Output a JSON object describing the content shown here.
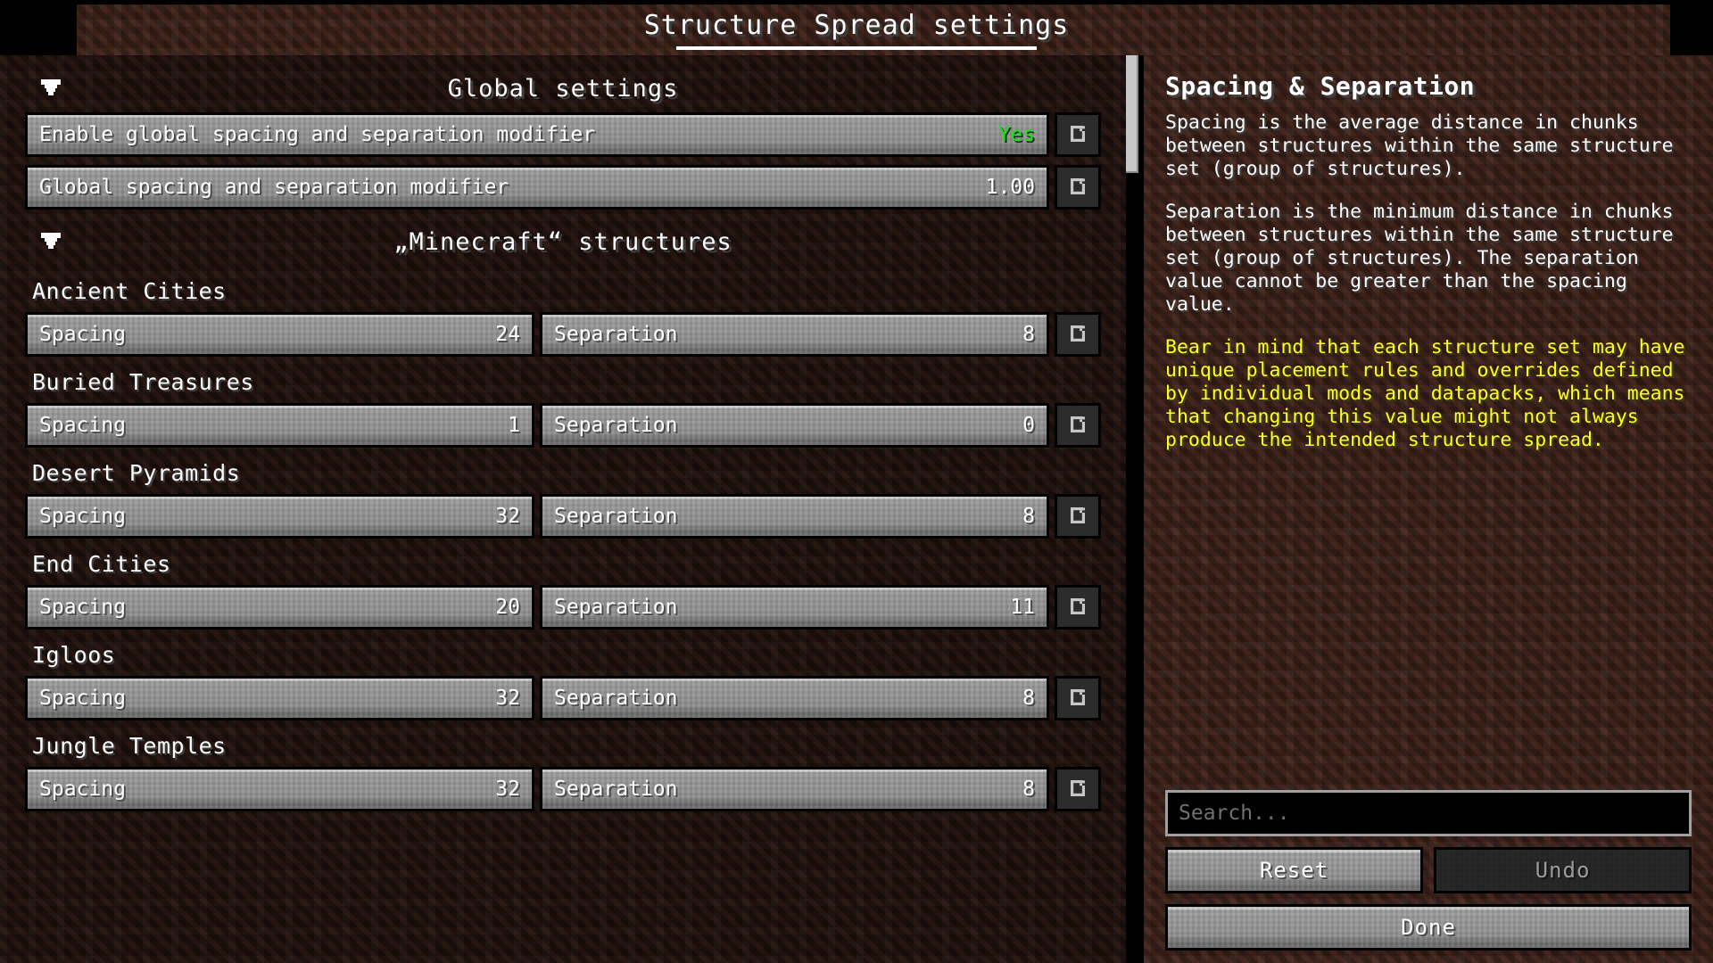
{
  "window": {
    "title": "Structure Spread settings"
  },
  "left_panel": {
    "global_group": {
      "label": "Global settings",
      "collapse_icon": "triangle-down-icon",
      "options": [
        {
          "label": "Enable global spacing and separation modifier",
          "value": "Yes",
          "value_color": "#22dd22",
          "reset_icon": "reset-arrow-icon"
        },
        {
          "label": "Global spacing and separation modifier",
          "value": "1.00",
          "value_color": "#ffffff",
          "reset_icon": "reset-arrow-icon"
        }
      ]
    },
    "minecraft_group": {
      "label": "„Minecraft“ structures",
      "collapse_icon": "triangle-down-icon",
      "spacing_label": "Spacing",
      "separation_label": "Separation",
      "reset_icon": "reset-arrow-icon",
      "structures": [
        {
          "name": "Ancient Cities",
          "spacing": "24",
          "separation": "8"
        },
        {
          "name": "Buried Treasures",
          "spacing": "1",
          "separation": "0"
        },
        {
          "name": "Desert Pyramids",
          "spacing": "32",
          "separation": "8"
        },
        {
          "name": "End Cities",
          "spacing": "20",
          "separation": "11"
        },
        {
          "name": "Igloos",
          "spacing": "32",
          "separation": "8"
        },
        {
          "name": "Jungle Temples",
          "spacing": "32",
          "separation": "8"
        }
      ]
    },
    "scrollbar": {
      "position": "top"
    }
  },
  "right_panel": {
    "title": "Spacing & Separation",
    "paragraphs": [
      "Spacing is the average distance in chunks between structures within the same structure set (group of structures).",
      "Separation is the minimum distance in chunks between structures within the same structure set (group of structures). The separation value cannot be greater than the spacing value."
    ],
    "warning": "Bear in mind that each structure set may have unique placement rules and overrides defined by individual mods and datapacks, which means that changing this value might not always produce the intended structure spread.",
    "warning_color": "#ffff22",
    "search": {
      "value": "",
      "placeholder": "Search..."
    },
    "buttons": {
      "reset": "Reset",
      "undo": "Undo",
      "undo_disabled": true,
      "done": "Done"
    }
  }
}
